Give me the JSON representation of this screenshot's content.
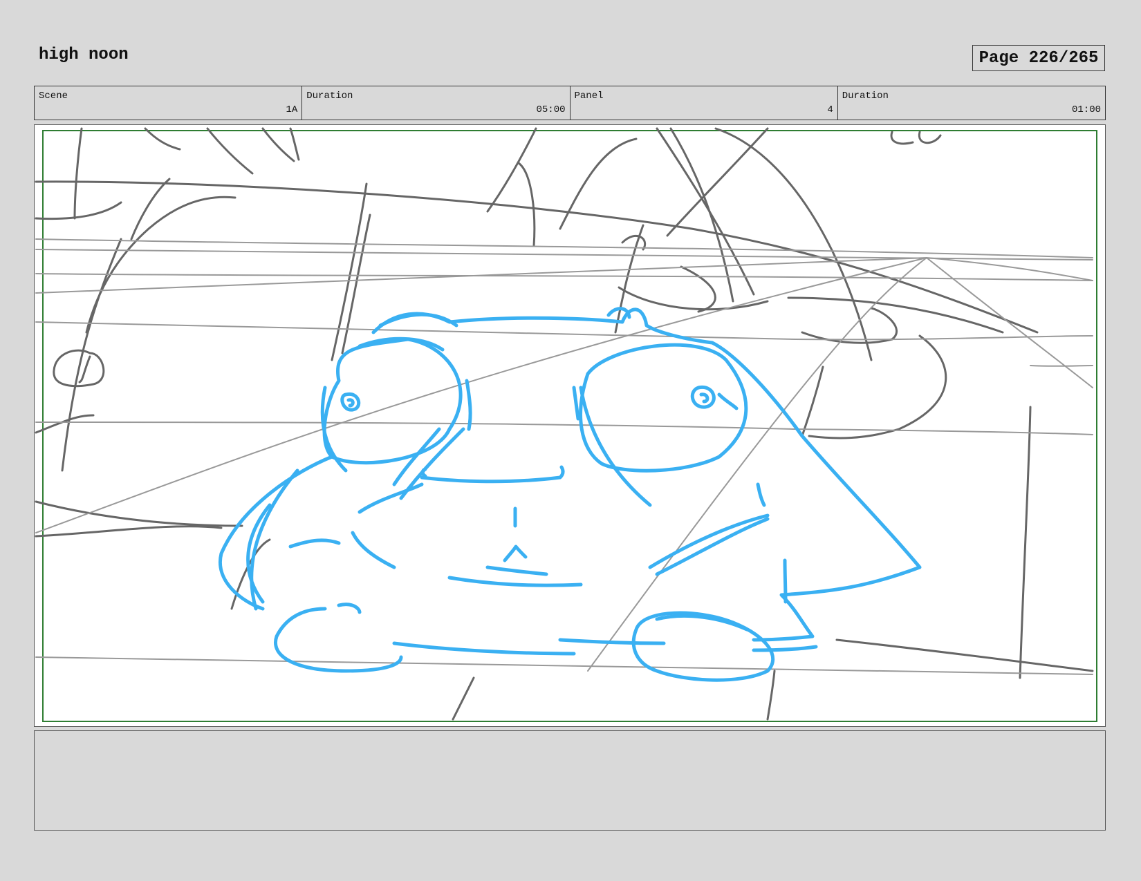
{
  "header": {
    "title": "high noon",
    "page": "Page 226/265"
  },
  "info": {
    "scene_label": "Scene",
    "scene_value": "1A",
    "scene_duration_label": "Duration",
    "scene_duration_value": "05:00",
    "panel_label": "Panel",
    "panel_value": "4",
    "panel_duration_label": "Duration",
    "panel_duration_value": "01:00"
  },
  "panel": {
    "safe_frame_color": "#2e7d32",
    "rough_color": "#666666",
    "character_color": "#3ab0f2"
  },
  "notes": {
    "text": ""
  }
}
